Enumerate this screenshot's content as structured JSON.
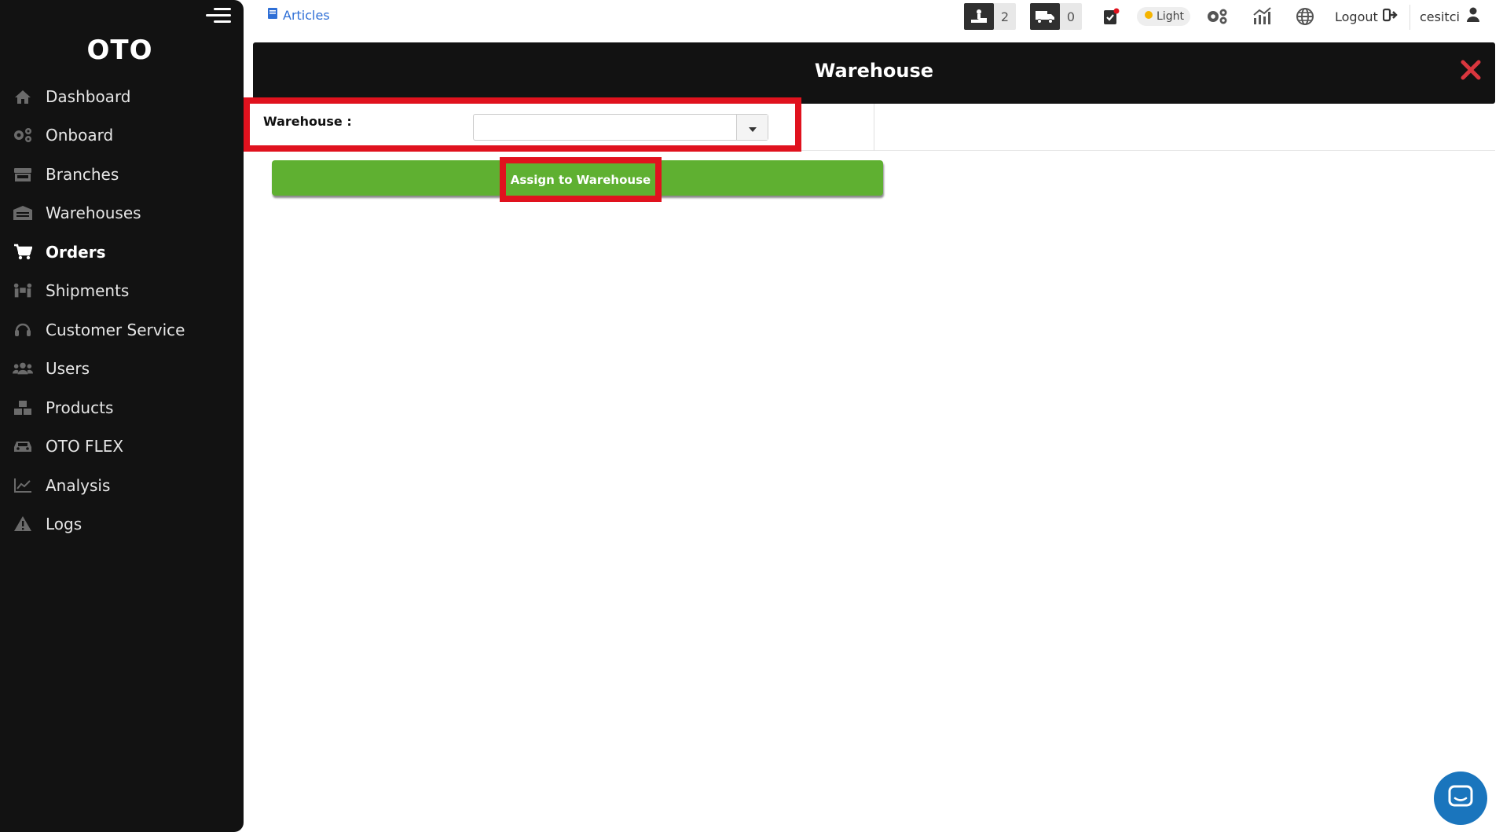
{
  "sidebar": {
    "brand": "OTO",
    "items": [
      {
        "label": "Dashboard",
        "icon": "home-icon"
      },
      {
        "label": "Onboard",
        "icon": "gears-icon"
      },
      {
        "label": "Branches",
        "icon": "store-icon"
      },
      {
        "label": "Warehouses",
        "icon": "warehouse-icon"
      },
      {
        "label": "Orders",
        "icon": "cart-icon",
        "active": true
      },
      {
        "label": "Shipments",
        "icon": "people-carry-icon"
      },
      {
        "label": "Customer Service",
        "icon": "headset-icon"
      },
      {
        "label": "Users",
        "icon": "users-icon"
      },
      {
        "label": "Products",
        "icon": "boxes-icon"
      },
      {
        "label": "OTO FLEX",
        "icon": "car-icon"
      },
      {
        "label": "Analysis",
        "icon": "chart-line-icon"
      },
      {
        "label": "Logs",
        "icon": "warning-icon"
      }
    ]
  },
  "topbar": {
    "articles": "Articles",
    "pickup_count": "2",
    "delivery_count": "0",
    "theme": "Light",
    "logout": "Logout",
    "username": "cesitci"
  },
  "modal": {
    "title": "Warehouse",
    "warehouse_label": "Warehouse :",
    "warehouse_value": "",
    "assign_button": "Assign to Warehouse"
  },
  "colors": {
    "sidebar_bg": "#121212",
    "accent_green": "#5fb031",
    "highlight_red": "#e0121e",
    "link_blue": "#2f6fd6",
    "close_red": "#d9363e",
    "chat_blue": "#1a75bd"
  }
}
